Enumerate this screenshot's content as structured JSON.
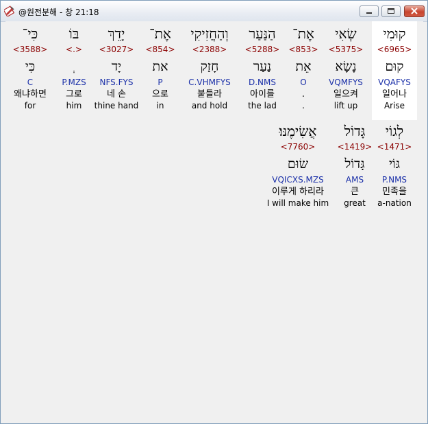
{
  "window": {
    "title": "@원전분해 - 창 21:18"
  },
  "words": [
    {
      "heb": "קוּמִי",
      "num": "<6965>",
      "lex": "קוּם",
      "parse": "VQAFYS",
      "kor": "일어나",
      "eng": "Arise"
    },
    {
      "heb": "שְׂאִי",
      "num": "<5375>",
      "lex": "נָשָׂא",
      "parse": "VQMFYS",
      "kor": "일으켜",
      "eng": "lift up"
    },
    {
      "heb": "אֶת־",
      "num": "<853>",
      "lex": "אֵת",
      "parse": "O",
      "kor": ".",
      "eng": "."
    },
    {
      "heb": "הַנַּעַר",
      "num": "<5288>",
      "lex": "נַעַר",
      "parse": "D.NMS",
      "kor": "아이를",
      "eng": "the lad"
    },
    {
      "heb": "וְהַחֲזִיקִי",
      "num": "<2388>",
      "lex": "חָזַק",
      "parse": "C.VHMFYS",
      "kor": "붙들라",
      "eng": "and hold"
    },
    {
      "heb": "אֶת־",
      "num": "<854>",
      "lex": "את",
      "parse": "P",
      "kor": "으로",
      "eng": "in"
    },
    {
      "heb": "יָדֵךְ",
      "num": "<3027>",
      "lex": "יָד",
      "parse": "NFS.FYS",
      "kor": "네 손",
      "eng": "thine hand"
    },
    {
      "heb": "בּוֹ",
      "num": "<.>",
      "lex": "ְ",
      "parse": "P.MZS",
      "kor": "그로",
      "eng": "him"
    },
    {
      "heb": "כִּי־",
      "num": "<3588>",
      "lex": "כִּי",
      "parse": "C",
      "kor": "왜냐하면",
      "eng": "for"
    },
    {
      "heb": "לְגוֹי",
      "num": "<1471>",
      "lex": "גּוֹי",
      "parse": "P.NMS",
      "kor": "민족을",
      "eng": "a-nation"
    },
    {
      "heb": "גָּדוֹל",
      "num": "<1419>",
      "lex": "גָּדוֹל",
      "parse": "AMS",
      "kor": "큰",
      "eng": "great"
    },
    {
      "heb": "אֲשִׂימֶנּוּ׃",
      "num": "<7760>",
      "lex": "שׂוּם",
      "parse": "VQICXS.MZS",
      "kor": "이루게 하리라",
      "eng": "I will make him"
    }
  ]
}
